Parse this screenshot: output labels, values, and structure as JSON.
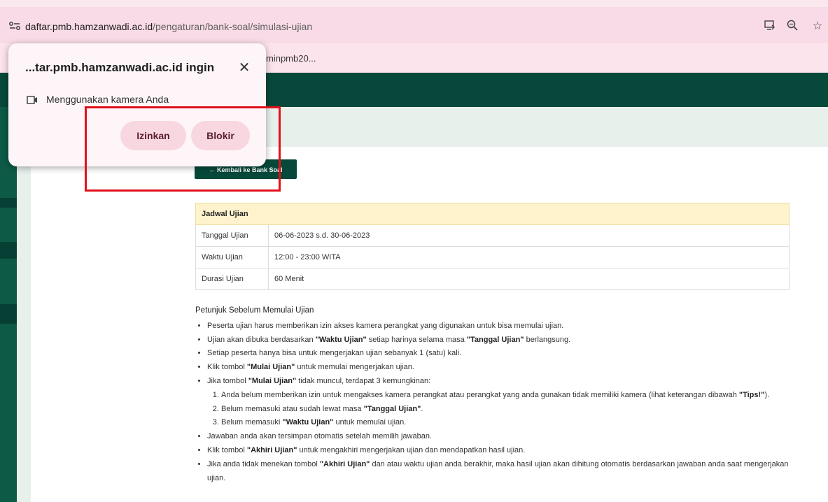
{
  "browser": {
    "url_host": "daftar.pmb.hamzanwadi.ac.id",
    "url_path": "/pengaturan/bank-soal/simulasi-ujian",
    "icons": [
      "site-info-icon",
      "install-app-icon",
      "zoom-icon",
      "bookmark-star-icon"
    ]
  },
  "app": {
    "pinkbar_user": "minpmb20...",
    "back_button": "← Kembali ke Bank Soal"
  },
  "popup": {
    "title": "...tar.pmb.hamzanwadi.ac.id ingin",
    "permission": "Menggunakan kamera Anda",
    "allow_label": "Izinkan",
    "block_label": "Blokir"
  },
  "jadwal": {
    "header": "Jadwal Ujian",
    "rows": [
      {
        "label": "Tanggal Ujian",
        "value": "06-06-2023 s.d. 30-06-2023"
      },
      {
        "label": "Waktu Ujian",
        "value": "12:00 - 23:00 WITA"
      },
      {
        "label": "Durasi Ujian",
        "value": "60 Menit"
      }
    ]
  },
  "instructions": {
    "title": "Petunjuk Sebelum Memulai Ujian",
    "b1": "Peserta ujian harus memberikan izin akses kamera perangkat yang digunakan untuk bisa memulai ujian.",
    "b2_pre": "Ujian akan dibuka berdasarkan ",
    "b2_bold1": "\"Waktu Ujian\"",
    "b2_mid": " setiap harinya selama masa ",
    "b2_bold2": "\"Tanggal Ujian\"",
    "b2_post": " berlangsung.",
    "b3": "Setiap peserta hanya bisa untuk mengerjakan ujian sebanyak 1 (satu) kali.",
    "b4_pre": "Klik tombol ",
    "b4_bold": "\"Mulai Ujian\"",
    "b4_post": " untuk memulai mengerjakan ujian.",
    "b5_pre": "Jika tombol ",
    "b5_bold": "\"Mulai Ujian\"",
    "b5_post": " tidak muncul, terdapat 3 kemungkinan:",
    "s1_pre": "Anda belum memberikan izin untuk mengakses kamera perangkat atau perangkat yang anda gunakan tidak memiliki kamera (lihat keterangan dibawah ",
    "s1_bold": "\"Tips!\"",
    "s1_post": ").",
    "s2_pre": "Belum memasuki atau sudah lewat masa ",
    "s2_bold": "\"Tanggal Ujian\"",
    "s2_post": ".",
    "s3_pre": "Belum memasuki ",
    "s3_bold": "\"Waktu Ujian\"",
    "s3_post": " untuk memulai ujian.",
    "b6": "Jawaban anda akan tersimpan otomatis setelah memilih jawaban.",
    "b7_pre": "Klik tombol ",
    "b7_bold": "\"Akhiri Ujian\"",
    "b7_post": " untuk mengakhiri mengerjakan ujian dan mendapatkan hasil ujian.",
    "b8_pre": "Jika anda tidak menekan tombol ",
    "b8_bold": "\"Akhiri Ujian\"",
    "b8_post": " dan atau waktu ujian anda berakhir, maka hasil ujian akan dihitung otomatis berdasarkan jawaban anda saat mengerjakan ujian."
  },
  "colors": {
    "brand_green": "#06493a",
    "annotation_red": "#e3101a",
    "table_header_bg": "#fff3cd",
    "popup_button_bg": "#f8d7e0"
  }
}
